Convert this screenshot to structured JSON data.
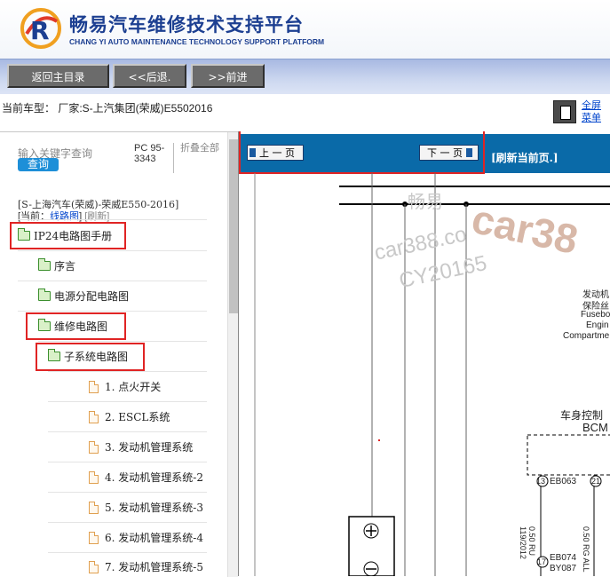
{
  "brand": {
    "title": "畅易汽车维修技术支持平台",
    "subtitle": "CHANG YI AUTO MAINTENANCE TECHNOLOGY SUPPORT PLATFORM"
  },
  "toolbar": {
    "home_label": "返回主目录",
    "back_label": "<<后退.",
    "forward_label": ">>前进"
  },
  "car_info": {
    "text": "当前车型： 厂家:S-上汽集团(荣威)E5502016"
  },
  "fullscreen": {
    "label": "全屏菜单"
  },
  "sidebar": {
    "search_placeholder": "输入关键字查询",
    "search_button": "查询",
    "pc_code": "PC 95-3343",
    "collapse_all": "折叠全部",
    "manual_title": "[S-上海汽车(荣威)-荣威E550-2016]",
    "current_prefix": "[当前：",
    "current_value": "线路图",
    "current_suffix": "]",
    "refresh_label": "[刷新]",
    "tree": [
      {
        "label": "IP24电路图手册",
        "type": "folder"
      },
      {
        "label": "序言",
        "type": "folder"
      },
      {
        "label": "电源分配电路图",
        "type": "folder"
      },
      {
        "label": "维修电路图",
        "type": "folder"
      },
      {
        "label": "子系统电路图",
        "type": "folder"
      },
      {
        "label": "1. 点火开关",
        "type": "page"
      },
      {
        "label": "2. ESCL系统",
        "type": "page"
      },
      {
        "label": "3. 发动机管理系统",
        "type": "page"
      },
      {
        "label": "4. 发动机管理系统-2",
        "type": "page"
      },
      {
        "label": "5. 发动机管理系统-3",
        "type": "page"
      },
      {
        "label": "6. 发动机管理系统-4",
        "type": "page"
      },
      {
        "label": "7. 发动机管理系统-5",
        "type": "page"
      }
    ]
  },
  "content_nav": {
    "prev_label": "上 一 页",
    "next_label": "下 一 页",
    "refresh_label": "[刷新当前页.]"
  },
  "diagram": {
    "watermark_1": "畅易",
    "watermark_2": "car388.co",
    "watermark_3": "CY20165",
    "watermark_big": "car38",
    "fuse_cn": "发动机",
    "fuse_cn2": "保险丝",
    "fuse_en1": "Fusebo",
    "fuse_en2": "Engin",
    "fuse_en3": "Compartme",
    "bcm_cn": "车身控制",
    "bcm_en": "BCM",
    "pin13": "13",
    "conn1": "EB063",
    "pin21": "21",
    "wire1": "0.50 RU",
    "wire1b": "119/2012",
    "wire2": "0.50 RG ALL",
    "pin17": "17",
    "conn2": "EB074",
    "conn3": "BY087"
  },
  "colors": {
    "brand_blue": "#1c3f91",
    "nav_blue": "#0a6aa8",
    "highlight_red": "#e02424",
    "toolbar_button": "#6b6b6b",
    "search_button": "#1e8fd8"
  }
}
